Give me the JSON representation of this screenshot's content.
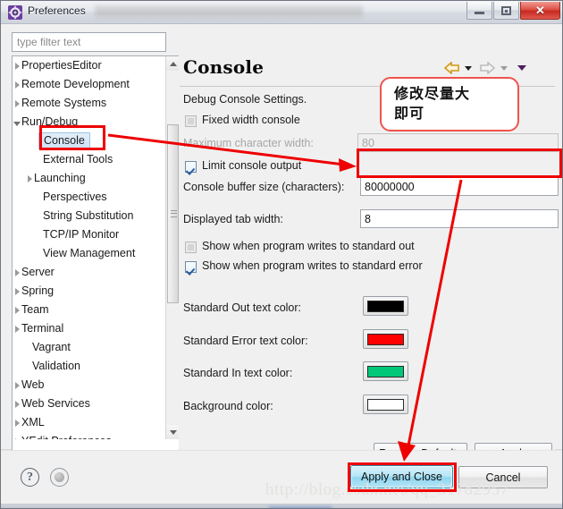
{
  "window": {
    "title": "Preferences",
    "icon": "preferences-gear-icon",
    "controls": {
      "minimize": "minimize-button",
      "maximize": "maximize-button",
      "close": "close-button",
      "close_glyph": "✕"
    }
  },
  "sidebar": {
    "filter": {
      "placeholder": "type filter text",
      "value": ""
    },
    "items": [
      {
        "label": "PropertiesEditor",
        "indent": 10,
        "state": "collapsed",
        "selected": false
      },
      {
        "label": "Remote Development",
        "indent": 10,
        "state": "collapsed",
        "selected": false
      },
      {
        "label": "Remote Systems",
        "indent": 10,
        "state": "collapsed",
        "selected": false
      },
      {
        "label": "Run/Debug",
        "indent": 10,
        "state": "expanded",
        "selected": false
      },
      {
        "label": "Console",
        "indent": 34,
        "state": "leaf",
        "selected": true
      },
      {
        "label": "External Tools",
        "indent": 34,
        "state": "leaf",
        "selected": false
      },
      {
        "label": "Launching",
        "indent": 24,
        "state": "collapsed",
        "selected": false
      },
      {
        "label": "Perspectives",
        "indent": 34,
        "state": "leaf",
        "selected": false
      },
      {
        "label": "String Substitution",
        "indent": 34,
        "state": "leaf",
        "selected": false
      },
      {
        "label": "TCP/IP Monitor",
        "indent": 34,
        "state": "leaf",
        "selected": false
      },
      {
        "label": "View Management",
        "indent": 34,
        "state": "leaf",
        "selected": false
      },
      {
        "label": "Server",
        "indent": 10,
        "state": "collapsed",
        "selected": false
      },
      {
        "label": "Spring",
        "indent": 10,
        "state": "collapsed",
        "selected": false
      },
      {
        "label": "Team",
        "indent": 10,
        "state": "collapsed",
        "selected": false
      },
      {
        "label": "Terminal",
        "indent": 10,
        "state": "collapsed",
        "selected": false
      },
      {
        "label": "Vagrant",
        "indent": 22,
        "state": "leaf",
        "selected": false
      },
      {
        "label": "Validation",
        "indent": 22,
        "state": "leaf",
        "selected": false
      },
      {
        "label": "Web",
        "indent": 10,
        "state": "collapsed",
        "selected": false
      },
      {
        "label": "Web Services",
        "indent": 10,
        "state": "collapsed",
        "selected": false
      },
      {
        "label": "XML",
        "indent": 10,
        "state": "collapsed",
        "selected": false
      },
      {
        "label": "YEdit Preferences",
        "indent": 10,
        "state": "collapsed",
        "selected": false
      }
    ],
    "scrollbar_vertical": "tree-vertical-scrollbar",
    "scrollbar_horizontal": "tree-horizontal-scrollbar"
  },
  "pane": {
    "title": "Console",
    "nav": {
      "back": "back-arrow-icon",
      "back_dropdown": "back-dropdown-caret",
      "forward": "forward-arrow-icon",
      "forward_dropdown": "forward-dropdown-caret",
      "menu": "view-menu-caret"
    },
    "description": "Debug Console Settings.",
    "fixed_width_console": {
      "label": "Fixed width console",
      "checked": false,
      "enabled": true
    },
    "max_char_width": {
      "label": "Maximum character width:",
      "value": "80",
      "enabled": false
    },
    "limit_console_output": {
      "label": "Limit console output",
      "checked": true,
      "enabled": true
    },
    "console_buffer_size": {
      "label": "Console buffer size (characters):",
      "value": "80000000"
    },
    "displayed_tab_width": {
      "label": "Displayed tab width:",
      "value": "8"
    },
    "show_stdout": {
      "label": "Show when program writes to standard out",
      "checked": false
    },
    "show_stderr": {
      "label": "Show when program writes to standard error",
      "checked": true
    },
    "colors": [
      {
        "label": "Standard Out text color:",
        "color": "#000000"
      },
      {
        "label": "Standard Error text color:",
        "color": "#FF0000"
      },
      {
        "label": "Standard In text color:",
        "color": "#00C878"
      },
      {
        "label": "Background color:",
        "color": "#FFFFFF"
      }
    ],
    "restore_defaults_label": "Restore Defaults",
    "apply_label": "Apply"
  },
  "footer": {
    "help_icon": "help-question-icon",
    "help_glyph": "?",
    "extra_icon": "record-circle-icon",
    "apply_and_close_label": "Apply and Close",
    "cancel_label": "Cancel"
  },
  "annotations": {
    "callout_line1": "修改尽量大",
    "callout_line2": "即可",
    "color": "#EE0000",
    "watermark": "http://blog.csdn.net/qq_31782957"
  }
}
